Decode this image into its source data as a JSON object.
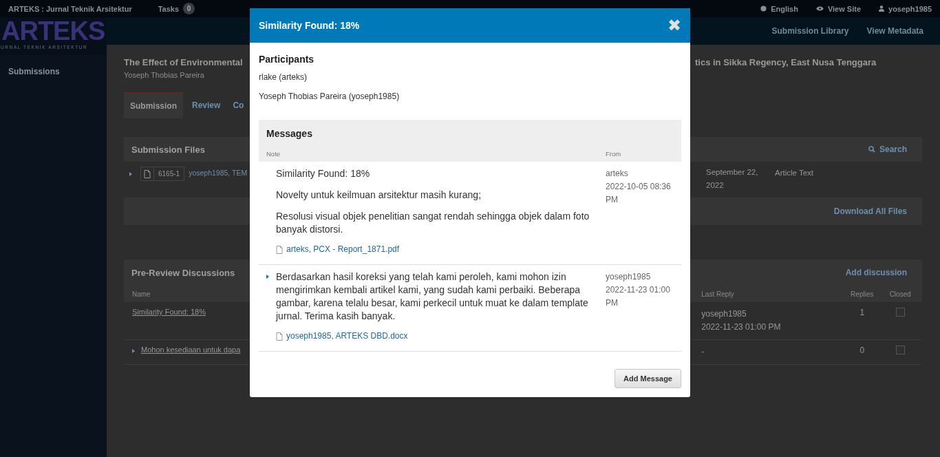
{
  "top_bar": {
    "site": "ARTEKS : Jurnal Teknik Arsitektur",
    "tasks_label": "Tasks",
    "tasks_count": "0",
    "language": "English",
    "view_site": "View Site",
    "user": "yoseph1985"
  },
  "logo": {
    "name": "ARTEKS",
    "tagline": "URNAL TEKNIK ARSITEKTUR"
  },
  "sidebar": {
    "items": [
      {
        "label": "Submissions",
        "selected": true
      }
    ]
  },
  "nav": {
    "links": [
      "Submission Library",
      "View Metadata"
    ]
  },
  "submission": {
    "title_left": "The Effect of Environmental",
    "title_right": "tics in Sikka Regency, East Nusa Tenggara",
    "author": "Yoseph Thobias Pareira"
  },
  "tabs": [
    {
      "label": "Submission",
      "selected": true
    },
    {
      "label": "Review",
      "selected": false
    },
    {
      "label": "Co",
      "selected": false
    }
  ],
  "files_panel": {
    "title": "Submission Files",
    "search": "Search",
    "file": {
      "id": "6165-1",
      "name": "yoseph1985, TEM",
      "date": "September 22, 2022",
      "type": "Article Text"
    },
    "download": "Download All Files"
  },
  "discussions_panel": {
    "title": "Pre-Review Discussions",
    "add": "Add discussion",
    "columns": {
      "name": "Name",
      "last_reply": "Last Reply",
      "replies": "Replies",
      "closed": "Closed"
    },
    "rows": [
      {
        "name": "Similarity Found: 18%",
        "expandable": false,
        "last_reply": [
          "yoseph1985",
          "2022-11-23 01:00 PM"
        ],
        "replies": "1",
        "closed": false
      },
      {
        "name": "Mohon kesediaan untuk dapa",
        "expandable": true,
        "last_reply": [
          "-"
        ],
        "replies": "0",
        "closed": false
      }
    ]
  },
  "modal": {
    "title": "Similarity Found: 18%",
    "close": "✖",
    "participants_title": "Participants",
    "participants": [
      "rlake (arteks)",
      "Yoseph Thobias Pareira (yoseph1985)"
    ],
    "messages_title": "Messages",
    "columns": {
      "note": "Note",
      "from": "From"
    },
    "messages": [
      {
        "expandable": false,
        "paragraphs": [
          "Similarity Found: 18%",
          "Novelty untuk keilmuan arsitektur masih kurang;",
          "Resolusi visual objek penelitian sangat rendah sehingga objek dalam foto banyak distorsi."
        ],
        "attachment": "arteks, PCX - Report_1871.pdf",
        "from": "arteks",
        "date": "2022-10-05 08:36 PM"
      },
      {
        "expandable": true,
        "paragraphs": [
          "Berdasarkan hasil koreksi yang telah kami peroleh, kami mohon izin mengirimkan kembali artikel kami, yang sudah kami perbaiki. Beberapa gambar, karena telalu besar, kami perkecil untuk muat ke dalam template jurnal. Terima kasih banyak."
        ],
        "attachment": "yoseph1985, ARTEKS DBD.docx",
        "from": "yoseph1985",
        "date": "2022-11-23 01:00 PM"
      }
    ],
    "add_message": "Add Message"
  }
}
